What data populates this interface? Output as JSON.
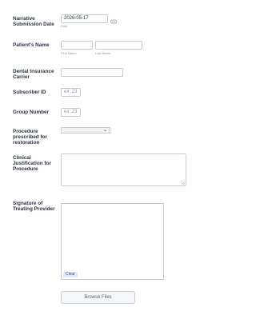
{
  "form": {
    "narrative_date": {
      "label": "Narrative Submission Date",
      "value": "2026-05-17",
      "sublabel": "Date",
      "icon": "calendar-icon"
    },
    "patient_name": {
      "label": "Patient's Name",
      "first_sublabel": "First Name",
      "last_sublabel": "Last Name",
      "first_value": "",
      "last_value": ""
    },
    "insurance_carrier": {
      "label": "Dental Insurance Carrier",
      "value": ""
    },
    "subscriber_id": {
      "label": "Subscriber ID",
      "placeholder": "ex: 23"
    },
    "group_number": {
      "label": "Group Number",
      "placeholder": "ex: 23"
    },
    "procedure": {
      "label": "Procedure prescribed for restoration",
      "selected": ""
    },
    "justification": {
      "label": "Clinical Justification for Procedure",
      "value": ""
    },
    "signature": {
      "label": "Signature of Treating Provider",
      "clear_label": "Clear"
    },
    "upload": {
      "button_label": "Browse Files"
    }
  },
  "colors": {
    "text": "#2c3345",
    "border": "#c3cad8",
    "muted": "#8a93a6",
    "clear_bg": "#dfe9f7"
  }
}
